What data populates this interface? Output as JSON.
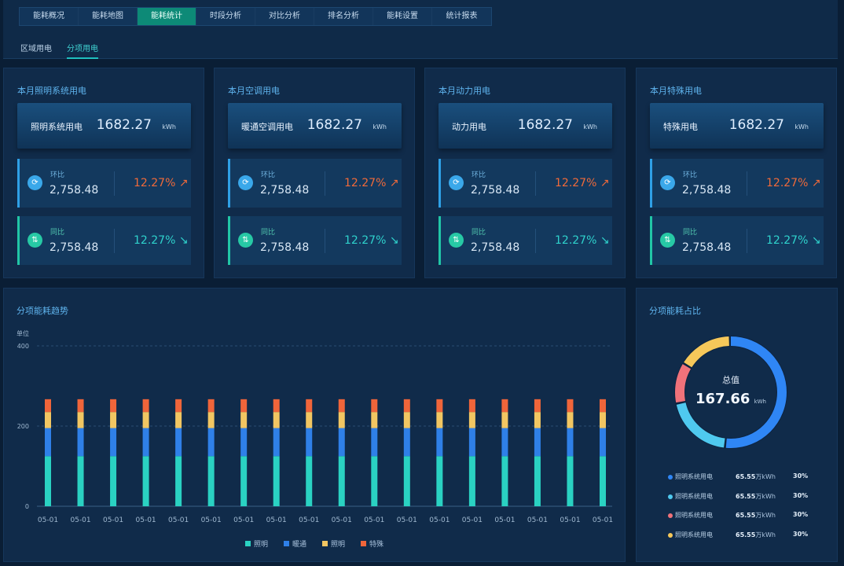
{
  "nav": {
    "tabs": [
      "能耗概况",
      "能耗地图",
      "能耗统计",
      "时段分析",
      "对比分析",
      "排名分析",
      "能耗设置",
      "统计报表"
    ],
    "active_tab": 2,
    "subtabs": [
      "区域用电",
      "分项用电"
    ],
    "active_subtab": 1
  },
  "cards": [
    {
      "title": "本月照明系统用电",
      "label": "照明系统用电",
      "value": "1682.27",
      "unit": "kWh",
      "hb": {
        "label": "环比",
        "num": "2,758.48",
        "pct": "12.27% ↗"
      },
      "tb": {
        "label": "同比",
        "num": "2,758.48",
        "pct": "12.27% ↘"
      }
    },
    {
      "title": "本月空调用电",
      "label": "暖通空调用电",
      "value": "1682.27",
      "unit": "kWh",
      "hb": {
        "label": "环比",
        "num": "2,758.48",
        "pct": "12.27% ↗"
      },
      "tb": {
        "label": "同比",
        "num": "2,758.48",
        "pct": "12.27% ↘"
      }
    },
    {
      "title": "本月动力用电",
      "label": "动力用电",
      "value": "1682.27",
      "unit": "kWh",
      "hb": {
        "label": "环比",
        "num": "2,758.48",
        "pct": "12.27% ↗"
      },
      "tb": {
        "label": "同比",
        "num": "2,758.48",
        "pct": "12.27% ↘"
      }
    },
    {
      "title": "本月特殊用电",
      "label": "特殊用电",
      "value": "1682.27",
      "unit": "kWh",
      "hb": {
        "label": "环比",
        "num": "2,758.48",
        "pct": "12.27% ↗"
      },
      "tb": {
        "label": "同比",
        "num": "2,758.48",
        "pct": "12.27% ↘"
      }
    }
  ],
  "trend": {
    "title": "分项能耗趋势"
  },
  "share": {
    "title": "分项能耗占比",
    "center_label": "总值",
    "center_value": "167.66",
    "center_unit": "kWh",
    "legend": [
      {
        "name": "照明系统用电",
        "value": "65.55",
        "unit": "万kWh",
        "pct": "30%",
        "color": "#2f86f5"
      },
      {
        "name": "照明系统用电",
        "value": "65.55",
        "unit": "万kWh",
        "pct": "30%",
        "color": "#4fc9ef"
      },
      {
        "name": "照明系统用电",
        "value": "65.55",
        "unit": "万kWh",
        "pct": "30%",
        "color": "#f0727a"
      },
      {
        "name": "照明系统用电",
        "value": "65.55",
        "unit": "万kWh",
        "pct": "30%",
        "color": "#f6c85a"
      }
    ]
  },
  "chart_data": [
    {
      "type": "bar",
      "stacked": true,
      "title": "分项能耗趋势",
      "ylabel": "单位",
      "ylim": [
        0,
        400
      ],
      "yticks": [
        0,
        200,
        400
      ],
      "grid": true,
      "legend_position": "bottom",
      "categories": [
        "05-01",
        "05-01",
        "05-01",
        "05-01",
        "05-01",
        "05-01",
        "05-01",
        "05-01",
        "05-01",
        "05-01",
        "05-01",
        "05-01",
        "05-01",
        "05-01",
        "05-01",
        "05-01",
        "05-01",
        "05-01"
      ],
      "series": [
        {
          "name": "照明",
          "color": "#2ad2c2",
          "values": [
            125,
            125,
            125,
            125,
            125,
            125,
            125,
            125,
            125,
            125,
            125,
            125,
            125,
            125,
            125,
            125,
            125,
            125
          ]
        },
        {
          "name": "暖通",
          "color": "#2f80e8",
          "values": [
            70,
            70,
            70,
            70,
            70,
            70,
            70,
            70,
            70,
            70,
            70,
            70,
            70,
            70,
            70,
            70,
            70,
            70
          ]
        },
        {
          "name": "照明",
          "color": "#f2c662",
          "values": [
            40,
            40,
            40,
            40,
            40,
            40,
            40,
            40,
            40,
            40,
            40,
            40,
            40,
            40,
            40,
            40,
            40,
            40
          ]
        },
        {
          "name": "特殊",
          "color": "#f0653a",
          "values": [
            32,
            32,
            32,
            32,
            32,
            32,
            32,
            32,
            32,
            32,
            32,
            32,
            32,
            32,
            32,
            32,
            32,
            32
          ]
        }
      ]
    },
    {
      "type": "pie",
      "donut": true,
      "title": "分项能耗占比",
      "labels": [
        "照明系统用电",
        "照明系统用电",
        "照明系统用电",
        "照明系统用电"
      ],
      "values": [
        52,
        20,
        12,
        16
      ],
      "colors": [
        "#2f86f5",
        "#4fc9ef",
        "#f0727a",
        "#f6c85a"
      ]
    }
  ]
}
